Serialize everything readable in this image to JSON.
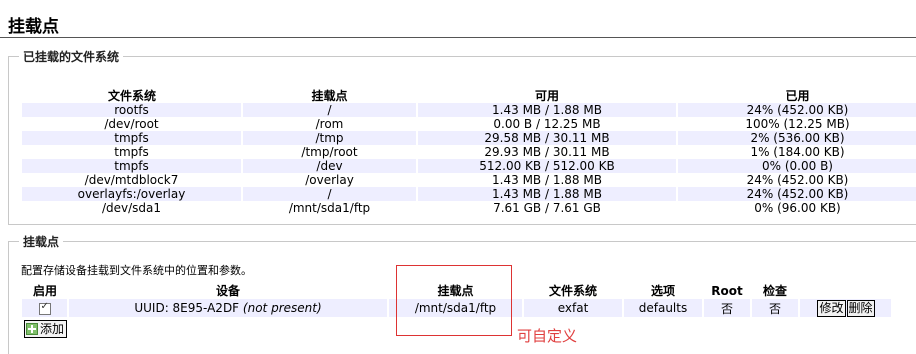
{
  "page": {
    "title": "挂载点"
  },
  "mounted_section": {
    "legend": "已挂载的文件系统",
    "headers": [
      "文件系统",
      "挂载点",
      "可用",
      "已用"
    ],
    "rows": [
      [
        "rootfs",
        "/",
        "1.43 MB / 1.88 MB",
        "24% (452.00 KB)"
      ],
      [
        "/dev/root",
        "/rom",
        "0.00 B / 12.25 MB",
        "100% (12.25 MB)"
      ],
      [
        "tmpfs",
        "/tmp",
        "29.58 MB / 30.11 MB",
        "2% (536.00 KB)"
      ],
      [
        "tmpfs",
        "/tmp/root",
        "29.93 MB / 30.11 MB",
        "1% (184.00 KB)"
      ],
      [
        "tmpfs",
        "/dev",
        "512.00 KB / 512.00 KB",
        "0% (0.00 B)"
      ],
      [
        "/dev/mtdblock7",
        "/overlay",
        "1.43 MB / 1.88 MB",
        "24% (452.00 KB)"
      ],
      [
        "overlayfs:/overlay",
        "/",
        "1.43 MB / 1.88 MB",
        "24% (452.00 KB)"
      ],
      [
        "/dev/sda1",
        "/mnt/sda1/ftp",
        "7.61 GB / 7.61 GB",
        "0% (96.00 KB)"
      ]
    ]
  },
  "mount_section": {
    "legend": "挂载点",
    "description": "配置存储设备挂载到文件系统中的位置和参数。",
    "headers": {
      "enabled": "启用",
      "device": "设备",
      "mountpoint": "挂载点",
      "filesystem": "文件系统",
      "options": "选项",
      "root": "Root",
      "check": "检查"
    },
    "row": {
      "enabled": true,
      "device_uuid": "UUID: 8E95-A2DF",
      "device_status": "(not present)",
      "mountpoint": "/mnt/sda1/ftp",
      "filesystem": "exfat",
      "options": "defaults",
      "root": "否",
      "check": "否",
      "edit_label": "修改",
      "delete_label": "删除"
    },
    "add_label": "添加"
  },
  "annotation": {
    "text": "可自定义",
    "color": "#e04040"
  }
}
